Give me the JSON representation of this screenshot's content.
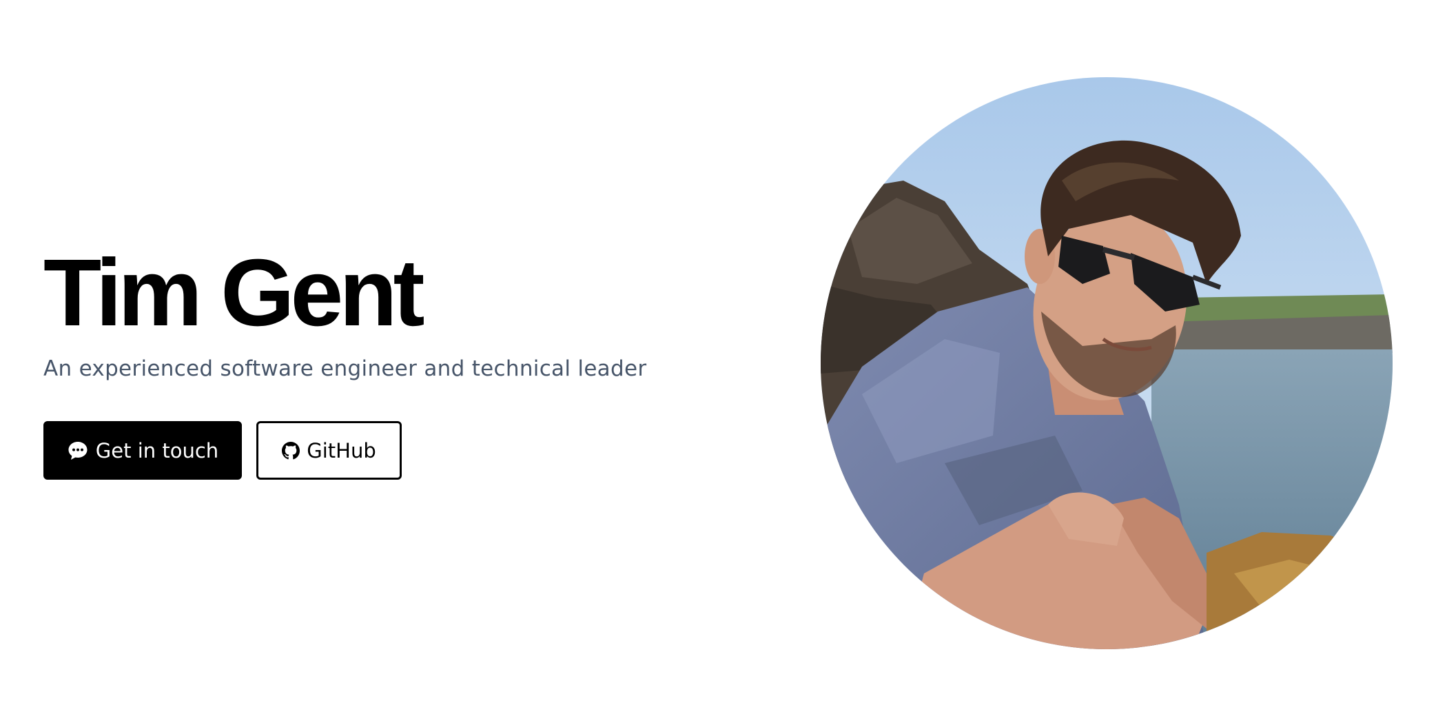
{
  "hero": {
    "name": "Tim Gent",
    "tagline": "An experienced software engineer and technical leader"
  },
  "actions": {
    "contact": {
      "label": "Get in touch",
      "icon": "chat-bubble-icon"
    },
    "github": {
      "label": "GitHub",
      "icon": "github-icon"
    }
  },
  "profile_photo": {
    "description_icon": "profile-photo"
  },
  "colors": {
    "primary": "#000000",
    "tagline": "#475569",
    "background": "#ffffff"
  }
}
